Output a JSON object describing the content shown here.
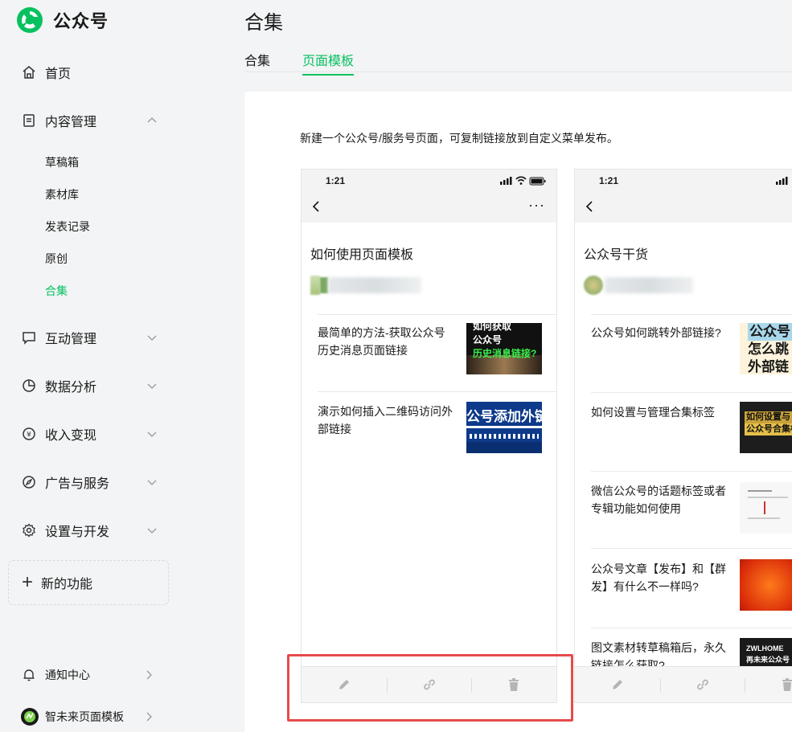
{
  "app": {
    "title": "公众号"
  },
  "sidebar": {
    "home": "首页",
    "content": {
      "label": "内容管理",
      "children": [
        "草稿箱",
        "素材库",
        "发表记录",
        "原创",
        "合集"
      ]
    },
    "interaction": "互动管理",
    "analytics": "数据分析",
    "monetize": "收入变现",
    "ads": "广告与服务",
    "settings": "设置与开发",
    "new_feature": "新的功能",
    "notifications": "通知中心",
    "account": "智未来页面模板"
  },
  "main": {
    "title": "合集",
    "tabs": [
      "合集",
      "页面模板"
    ],
    "active_tab": "页面模板",
    "description": "新建一个公众号/服务号页面，可复制链接放到自定义菜单发布。"
  },
  "templates": [
    {
      "time": "1:21",
      "title": "如何使用页面模板",
      "articles": [
        {
          "title": "最简单的方法-获取公众号历史消息页面链接",
          "thumb_text": [
            "如何获取",
            "公众号",
            "历史消息链接?"
          ]
        },
        {
          "title": "演示如何插入二维码访问外部链接",
          "thumb_text": [
            "公号添加外链"
          ]
        }
      ]
    },
    {
      "time": "1:21",
      "title": "公众号干货",
      "articles": [
        {
          "title": "公众号如何跳转外部链接?",
          "thumb_text": [
            "公众号",
            "怎么跳",
            "外部链"
          ]
        },
        {
          "title": "如何设置与管理合集标签",
          "thumb_text": [
            "如何设置与",
            "公众号合集标"
          ]
        },
        {
          "title": "微信公众号的话题标签或者专辑功能如何使用",
          "thumb_text": []
        },
        {
          "title": "公众号文章【发布】和【群发】有什么不一样吗?",
          "thumb_text": []
        },
        {
          "title": "图文素材转草稿箱后，永久链接怎么获取?",
          "thumb_text": [
            "ZWLHOME",
            "再未来公众号"
          ]
        }
      ]
    }
  ],
  "colors": {
    "accent": "#07c160",
    "highlight": "#e64b4b"
  }
}
